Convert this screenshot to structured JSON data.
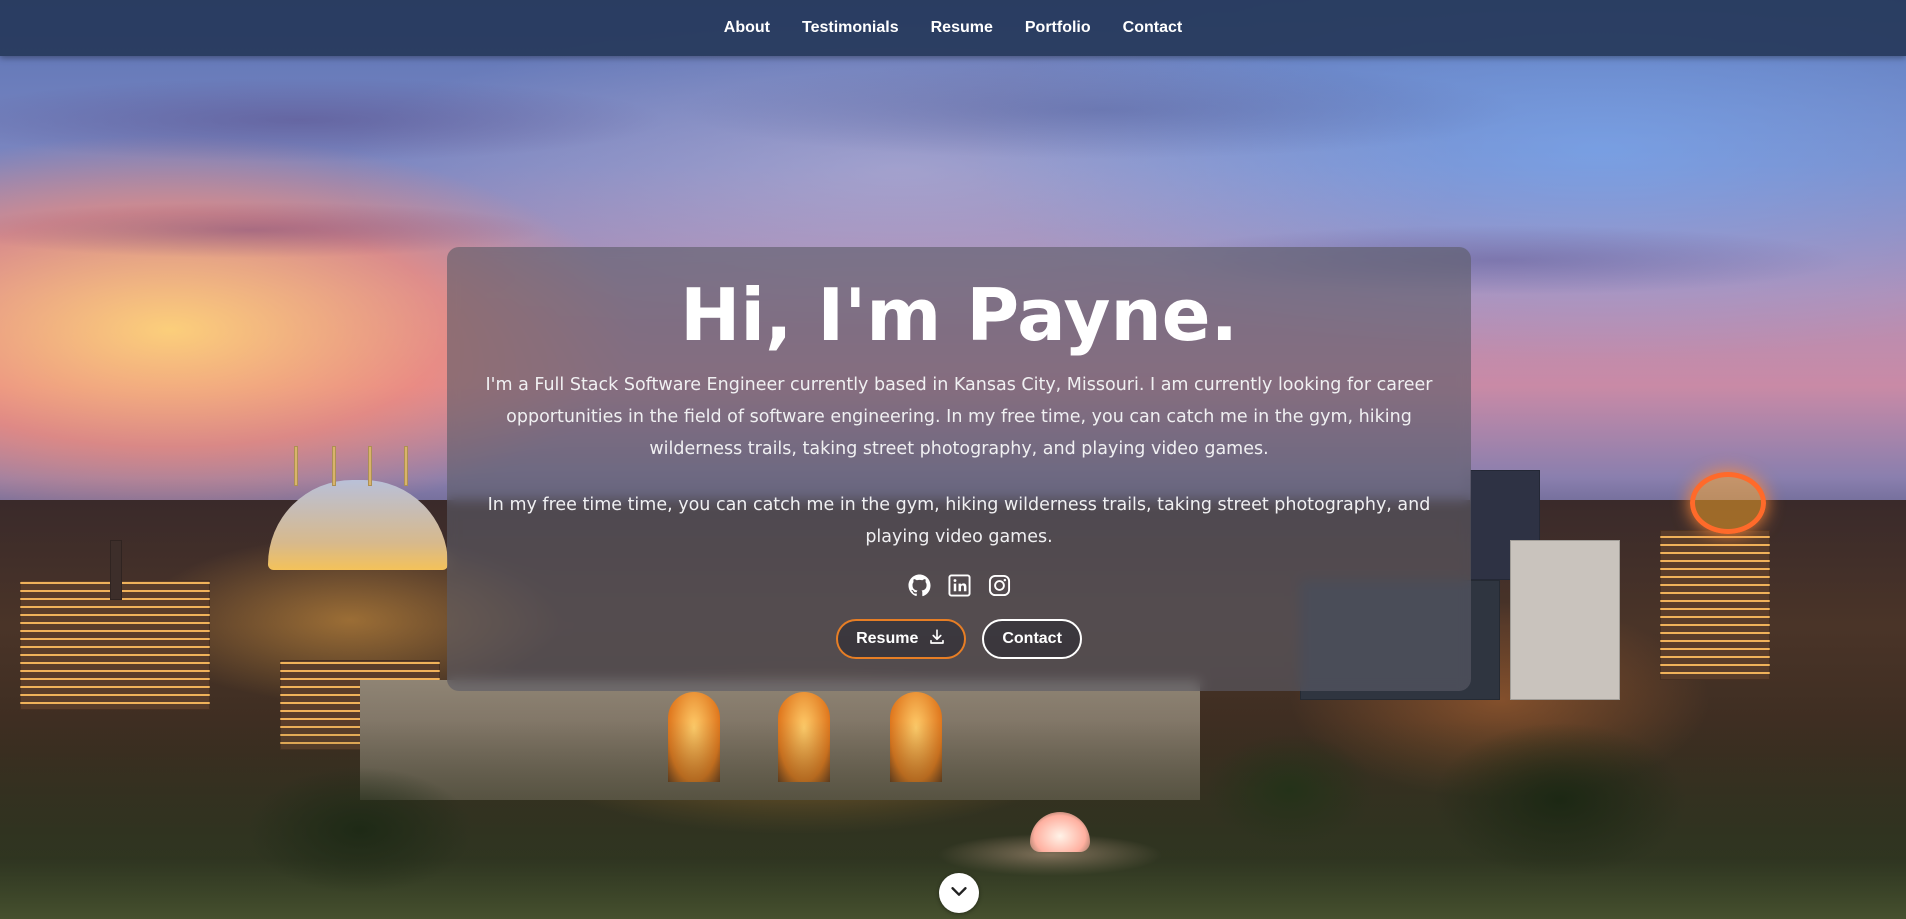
{
  "nav": {
    "links": [
      "About",
      "Testimonials",
      "Resume",
      "Portfolio",
      "Contact"
    ]
  },
  "hero": {
    "title": "Hi, I'm Payne.",
    "paragraph1": "I'm a Full Stack Software Engineer currently based in Kansas City, Missouri. I am currently looking for career opportunities in the field of software engineering. In my free time, you can catch me in the gym, hiking wilderness trails, taking street photography, and playing video games.",
    "paragraph2": "In my free time time, you can catch me in the gym, hiking wilderness trails, taking street photography, and playing video games.",
    "social_icons": [
      "github-icon",
      "linkedin-icon",
      "instagram-icon"
    ],
    "resume_button": "Resume",
    "contact_button": "Contact"
  },
  "colors": {
    "accent": "#e77e25",
    "nav_bg": "#26385a"
  }
}
